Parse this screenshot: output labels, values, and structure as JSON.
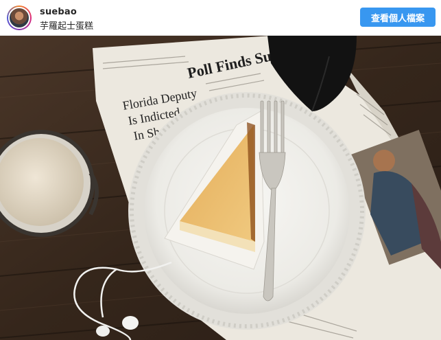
{
  "header": {
    "username": "suebao",
    "subtitle": "芋羅起士蛋糕",
    "view_profile_label": "查看個人檔案"
  },
  "photo": {
    "newspaper_headline_1": "Poll Finds Suppo",
    "newspaper_headline_2a": "Florida Deputy",
    "newspaper_headline_2b": "Is Indicted",
    "newspaper_headline_2c": "In Sh"
  },
  "colors": {
    "button": "#3897f0",
    "wood_dark": "#3b2a1e",
    "plate": "#f4f2ee",
    "cake": "#e9b760"
  }
}
